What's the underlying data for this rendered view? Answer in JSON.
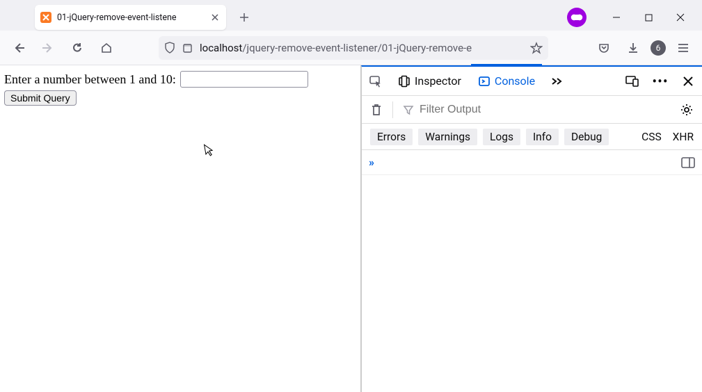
{
  "tab": {
    "title": "01-jQuery-remove-event-listene"
  },
  "nav": {
    "url_host": "localhost",
    "url_path": "/jquery-remove-event-listener/01-jQuery-remove-e",
    "badge_count": "6"
  },
  "page": {
    "label": "Enter a number between 1 and 10:",
    "number_value": "",
    "submit_label": "Submit Query"
  },
  "devtools": {
    "tabs": {
      "inspector": "Inspector",
      "console": "Console"
    },
    "filter_placeholder": "Filter Output",
    "categories": {
      "errors": "Errors",
      "warnings": "Warnings",
      "logs": "Logs",
      "info": "Info",
      "debug": "Debug",
      "css": "CSS",
      "xhr": "XHR"
    }
  }
}
